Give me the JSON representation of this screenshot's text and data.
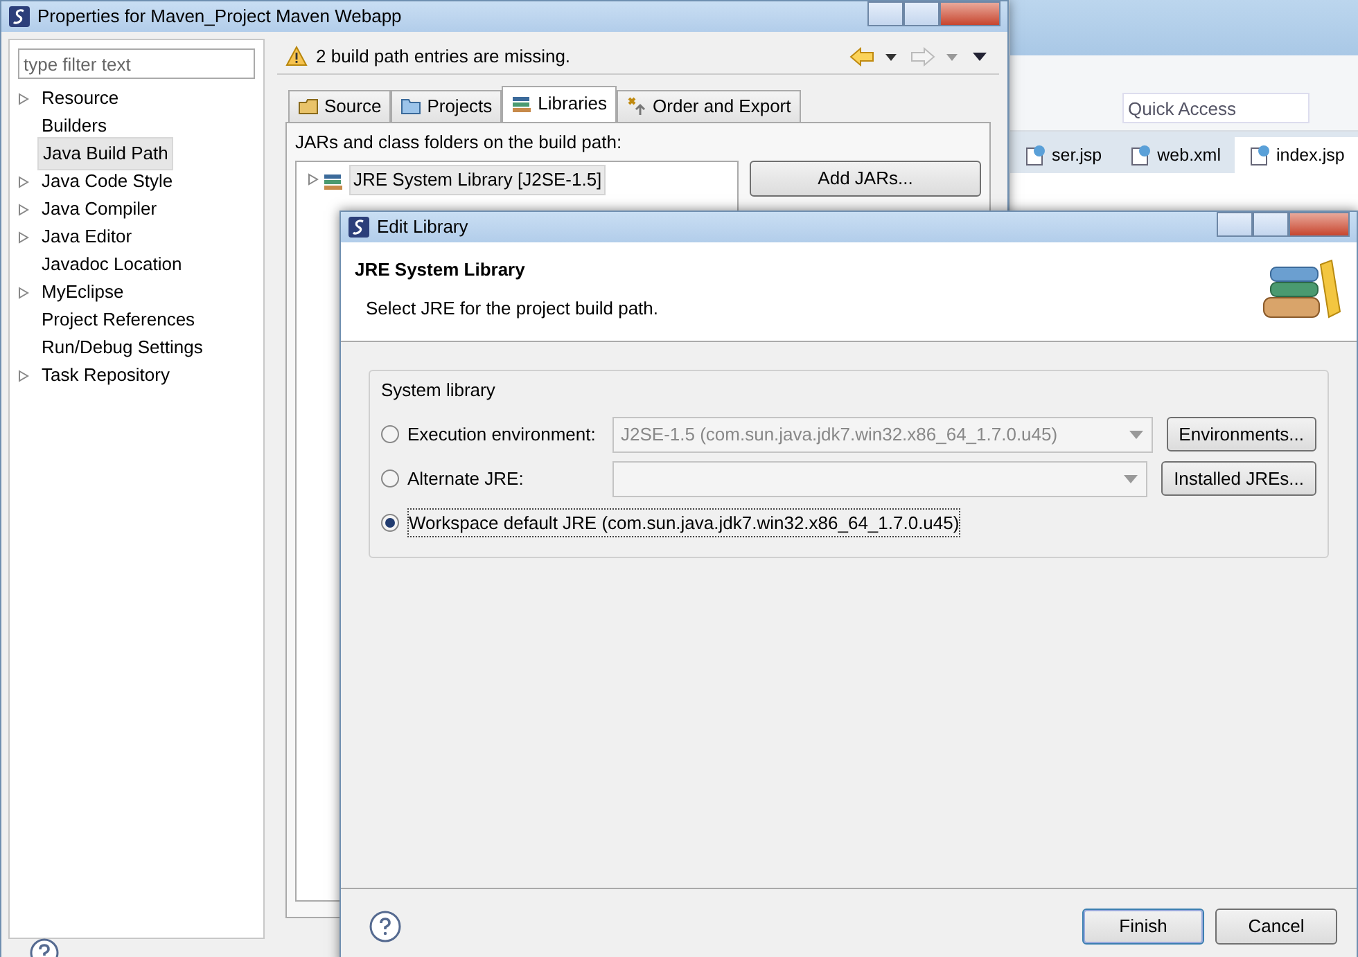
{
  "workbench": {
    "quick_access": {
      "placeholder": "Quick Access"
    },
    "editor_tabs": [
      {
        "label": "ser.jsp",
        "selected": false
      },
      {
        "label": "web.xml",
        "selected": false
      },
      {
        "label": "index.jsp",
        "selected": true
      }
    ]
  },
  "properties_window": {
    "title": "Properties for Maven_Project Maven Webapp",
    "filter": {
      "placeholder": "type filter text"
    },
    "tree": [
      {
        "label": "Resource",
        "expandable": true,
        "selected": false
      },
      {
        "label": "Builders",
        "expandable": false,
        "selected": false
      },
      {
        "label": "Java Build Path",
        "expandable": false,
        "selected": true
      },
      {
        "label": "Java Code Style",
        "expandable": true,
        "selected": false
      },
      {
        "label": "Java Compiler",
        "expandable": true,
        "selected": false
      },
      {
        "label": "Java Editor",
        "expandable": true,
        "selected": false
      },
      {
        "label": "Javadoc Location",
        "expandable": false,
        "selected": false
      },
      {
        "label": "MyEclipse",
        "expandable": true,
        "selected": false
      },
      {
        "label": "Project References",
        "expandable": false,
        "selected": false
      },
      {
        "label": "Run/Debug Settings",
        "expandable": false,
        "selected": false
      },
      {
        "label": "Task Repository",
        "expandable": true,
        "selected": false
      }
    ],
    "message": "2 build path entries are missing.",
    "tabs": [
      {
        "label": "Source",
        "selected": false
      },
      {
        "label": "Projects",
        "selected": false
      },
      {
        "label": "Libraries",
        "selected": true
      },
      {
        "label": "Order and Export",
        "selected": false
      }
    ],
    "description": "JARs and class folders on the build path:",
    "libraries": [
      {
        "label": "JRE System Library [J2SE-1.5]",
        "selected": true
      }
    ],
    "buttons": [
      "Add JARs..."
    ]
  },
  "dialog": {
    "title": "Edit Library",
    "heading": "JRE System Library",
    "description": "Select JRE for the project build path.",
    "group": "System library",
    "options": [
      {
        "kind": "combo",
        "label": "Execution environment:",
        "selected": false,
        "value": "J2SE-1.5 (com.sun.java.jdk7.win32.x86_64_1.7.0.u45)",
        "button": "Environments..."
      },
      {
        "kind": "combo",
        "label": "Alternate JRE:",
        "selected": false,
        "button": "Installed JREs..."
      },
      {
        "kind": "plain",
        "label": "Workspace default JRE (com.sun.java.jdk7.win32.x86_64_1.7.0.u45)",
        "selected": true
      }
    ],
    "buttons": [
      {
        "label": "Finish",
        "default": true
      },
      {
        "label": "Cancel",
        "default": false
      }
    ]
  }
}
